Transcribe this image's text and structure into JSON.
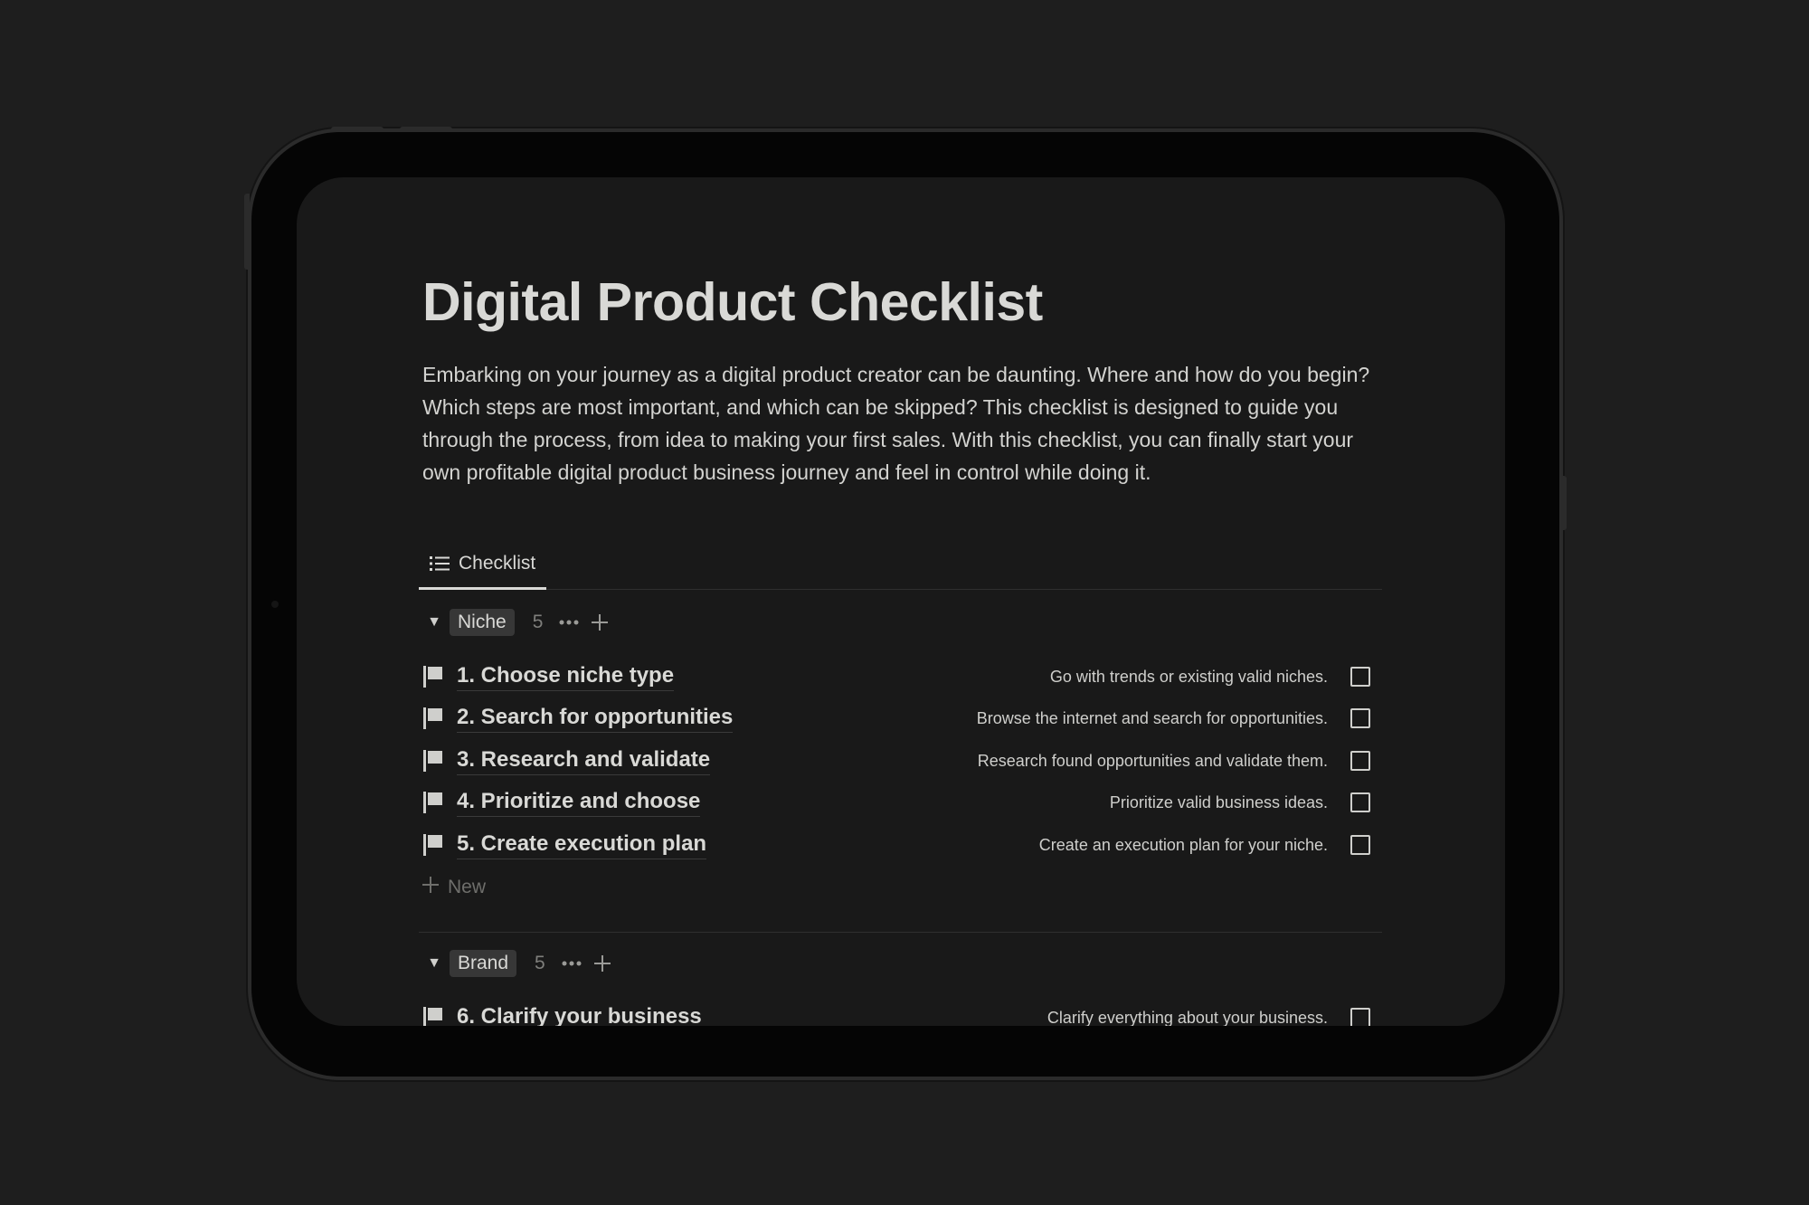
{
  "page": {
    "title": "Digital Product Checklist",
    "description": "Embarking on your journey as a digital product creator can be daunting. Where and how do you begin? Which steps are most important, and which can be skipped? This checklist is designed to guide you through the process, from idea to making your first sales. With this checklist, you can finally start your own profitable digital product business journey and feel in control while doing it."
  },
  "view_tab": {
    "label": "Checklist",
    "icon": "list-icon"
  },
  "groups": [
    {
      "name": "Niche",
      "count": "5",
      "items": [
        {
          "title": "1. Choose niche type",
          "description": "Go with trends or existing valid niches.",
          "checked": false
        },
        {
          "title": "2. Search for opportunities",
          "description": "Browse the internet and search for opportunities.",
          "checked": false
        },
        {
          "title": "3. Research and validate",
          "description": "Research found opportunities and validate them.",
          "checked": false
        },
        {
          "title": "4. Prioritize and choose",
          "description": "Prioritize valid business ideas.",
          "checked": false
        },
        {
          "title": "5. Create execution plan",
          "description": "Create an execution plan for your niche.",
          "checked": false
        }
      ],
      "new_label": "New"
    },
    {
      "name": "Brand",
      "count": "5",
      "items": [
        {
          "title": "6. Clarify your business",
          "description": "Clarify everything about your business.",
          "checked": false
        }
      ]
    }
  ],
  "colors": {
    "background": "#1e1e1e",
    "screen": "#191919",
    "text": "#d9d9d6",
    "muted": "#8a8a87",
    "pill": "#373737"
  }
}
